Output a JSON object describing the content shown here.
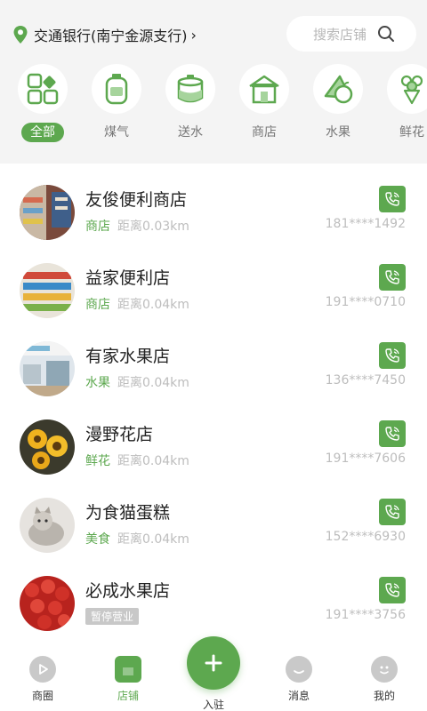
{
  "colors": {
    "accent": "#5da84f",
    "muted": "#bdbdbd",
    "header_bg": "#f4f4f4"
  },
  "header": {
    "location": "交通银行(南宁金源支行)",
    "search_placeholder": "搜索店铺"
  },
  "categories": [
    {
      "label": "全部",
      "icon": "grid-icon",
      "active": true
    },
    {
      "label": "煤气",
      "icon": "gas-tank-icon",
      "active": false
    },
    {
      "label": "送水",
      "icon": "water-bucket-icon",
      "active": false
    },
    {
      "label": "商店",
      "icon": "store-icon",
      "active": false
    },
    {
      "label": "水果",
      "icon": "fruit-icon",
      "active": false
    },
    {
      "label": "鲜花",
      "icon": "flower-icon",
      "active": false
    }
  ],
  "shops": [
    {
      "name": "友俊便利商店",
      "tag": "商店",
      "distance": "距离0.03km",
      "phone": "181****1492",
      "status": "",
      "avatar": "store-shelf-photo"
    },
    {
      "name": "益家便利店",
      "tag": "商店",
      "distance": "距离0.04km",
      "phone": "191****0710",
      "status": "",
      "avatar": "snack-shelf-photo"
    },
    {
      "name": "有家水果店",
      "tag": "水果",
      "distance": "距离0.04km",
      "phone": "136****7450",
      "status": "",
      "avatar": "fruit-store-photo"
    },
    {
      "name": "漫野花店",
      "tag": "鲜花",
      "distance": "距离0.04km",
      "phone": "191****7606",
      "status": "",
      "avatar": "sunflower-photo"
    },
    {
      "name": "为食猫蛋糕",
      "tag": "美食",
      "distance": "距离0.04km",
      "phone": "152****6930",
      "status": "",
      "avatar": "cat-photo"
    },
    {
      "name": "必成水果店",
      "tag": "",
      "distance": "",
      "phone": "191****3756",
      "status": "暂停营业",
      "avatar": "lychee-photo"
    }
  ],
  "tabbar": {
    "items": [
      {
        "label": "商圈",
        "icon": "play-circle-icon",
        "active": false
      },
      {
        "label": "店铺",
        "icon": "store-tab-icon",
        "active": true
      },
      {
        "label": "消息",
        "icon": "message-face-icon",
        "active": false
      },
      {
        "label": "我的",
        "icon": "profile-face-icon",
        "active": false
      }
    ],
    "center_label": "入驻"
  }
}
